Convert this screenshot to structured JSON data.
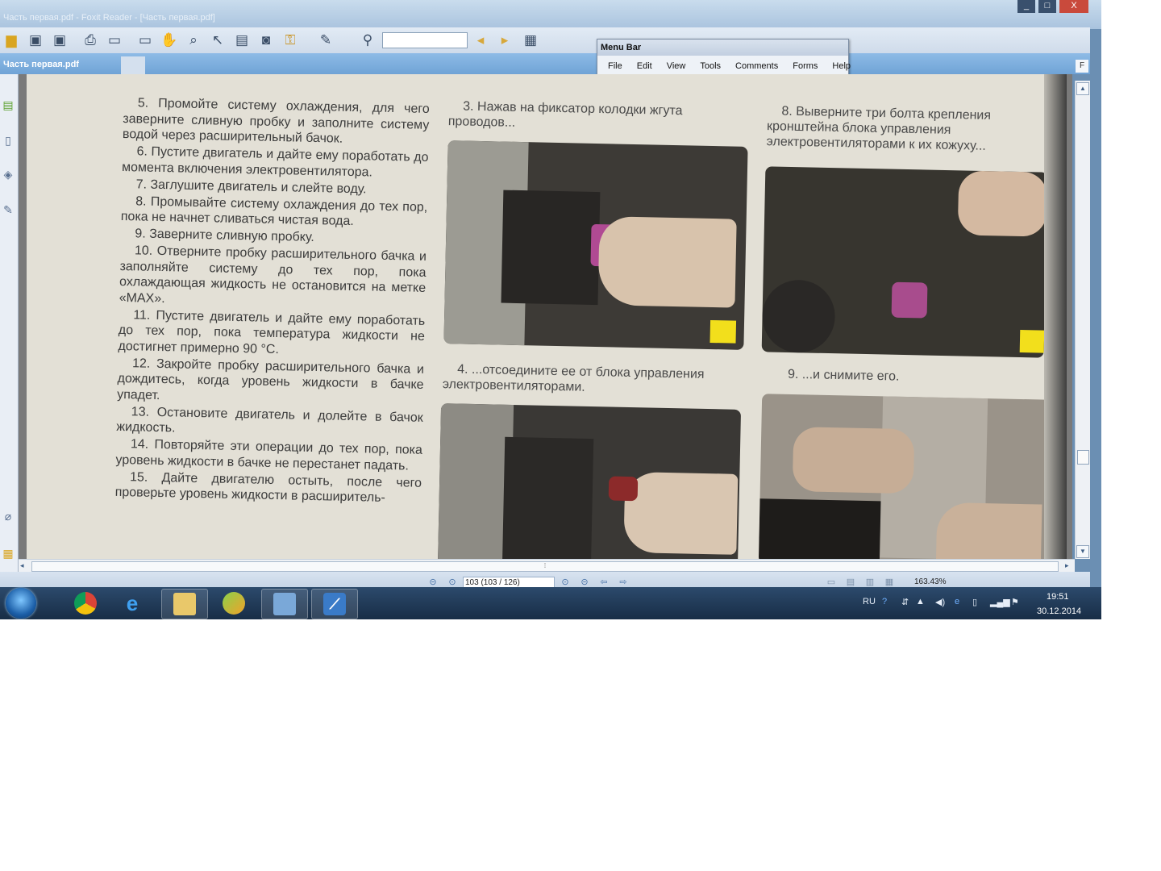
{
  "window": {
    "title": "Часть первая.pdf - Foxit Reader - [Часть первая.pdf]",
    "caption_buttons": [
      "_",
      "□",
      "X"
    ]
  },
  "tab": {
    "label": "Часть первая.pdf",
    "right_button": "F"
  },
  "menubar": {
    "title": "Menu Bar",
    "items": [
      "File",
      "Edit",
      "View",
      "Tools",
      "Comments",
      "Forms",
      "Help"
    ]
  },
  "toolbar": {
    "find_value": "",
    "icons": [
      "open-icon",
      "save-icon",
      "save-as-icon",
      "print-icon",
      "email-icon",
      "fullscreen-icon",
      "hand-tool-icon",
      "zoom-tool-icon",
      "select-icon",
      "text-select-icon",
      "snapshot-icon",
      "rms-icon",
      "typewriter-icon",
      "find-icon",
      "find-prev-icon",
      "find-next-icon",
      "find-options-icon"
    ]
  },
  "document": {
    "col1": [
      "5. Промойте систему охлаждения, для чего заверните сливную пробку и заполните систему водой через расширительный бачок.",
      "6. Пустите двигатель и дайте ему поработать до момента включения электровентилятора.",
      "7. Заглушите двигатель и слейте воду.",
      "8. Промывайте систему охлаждения до тех пор, пока не начнет сливаться чистая вода.",
      "9. Заверните сливную пробку.",
      "10. Отверните пробку расширительного бачка и заполняйте систему до тех пор, пока охлаждающая жидкость не остановится на метке «MAX».",
      "11. Пустите двигатель и дайте ему поработать до тех пор, пока температура жидкости не достигнет примерно 90 °C.",
      "12. Закройте пробку расширительного бачка и дождитесь, когда уровень жидкости в бачке упадет.",
      "13. Остановите двигатель и долейте в бачок жидкость.",
      "14. Повторяйте эти операции до тех пор, пока уровень жидкости в бачке не перестанет падать.",
      "15. Дайте двигателю остыть, после чего проверьте уровень жидкости в расширитель-"
    ],
    "caption3": "3. Нажав на фиксатор колодки жгута проводов...",
    "caption4": "4. ...отсоедините ее от блока управления электровентиляторами.",
    "caption8": "8. Выверните три болта крепления кронштейна блока управления электровентиляторами к их кожуху...",
    "caption9": "9. ...и снимите его."
  },
  "statusbar": {
    "page_indicator": "103 (103 / 126)",
    "zoom": "163.43%"
  },
  "taskbar": {
    "apps": [
      "chrome",
      "internet-explorer",
      "file-explorer",
      "media-app",
      "remote-desktop",
      "foxit-reader"
    ],
    "language": "RU",
    "time": "19:51",
    "date": "30.12.2014"
  }
}
